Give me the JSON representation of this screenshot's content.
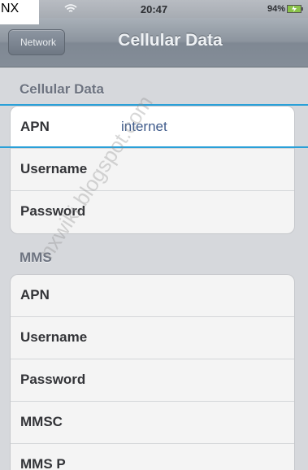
{
  "status": {
    "time": "20:47",
    "battery": "94%"
  },
  "nx_label": "NX",
  "navbar": {
    "back": "Network",
    "title": "Cellular Data"
  },
  "sections": {
    "cellular": {
      "header": "Cellular Data",
      "rows": [
        {
          "label": "APN",
          "value": "internet"
        },
        {
          "label": "Username",
          "value": ""
        },
        {
          "label": "Password",
          "value": ""
        }
      ]
    },
    "mms": {
      "header": "MMS",
      "rows": [
        {
          "label": "APN"
        },
        {
          "label": "Username"
        },
        {
          "label": "Password"
        },
        {
          "label": "MMSC"
        },
        {
          "label": "MMS P"
        }
      ]
    }
  },
  "watermark": "nxwiki.blogspot.com",
  "colors": {
    "accent": "#2aa0d8",
    "value_text": "#3f5b8b"
  }
}
